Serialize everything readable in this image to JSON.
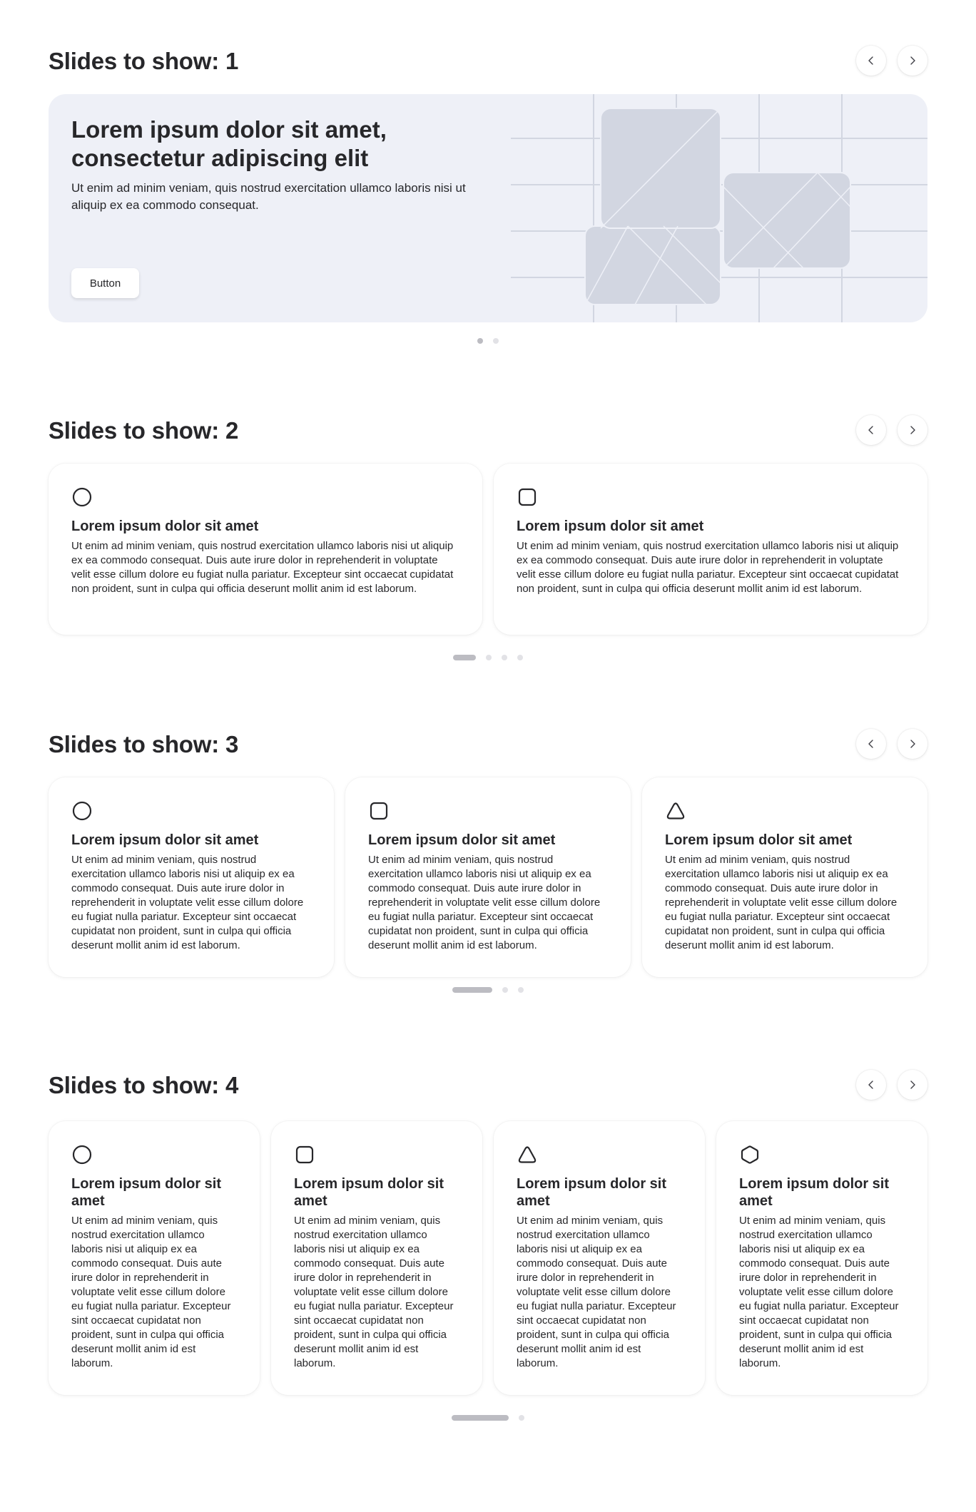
{
  "icons": {
    "prev": "chevron-left-icon",
    "next": "chevron-right-icon",
    "shapes": [
      "circle-icon",
      "square-icon",
      "triangle-icon",
      "hexagon-icon"
    ]
  },
  "colors": {
    "hero_bg": "#eef0f7",
    "dot_active": "#bcbcc2",
    "dot_inactive": "#e2e2e6",
    "text": "#27272a"
  },
  "sections": [
    {
      "title": "Slides to show: 1",
      "hero": {
        "title": "Lorem ipsum dolor sit amet, consectetur adipiscing elit",
        "description": "Ut enim ad minim veniam, quis nostrud exercitation ullamco laboris nisi ut aliquip ex ea commodo consequat.",
        "button": "Button"
      },
      "dots": {
        "count": 2,
        "active": 1
      }
    },
    {
      "title": "Slides to show: 2",
      "cards": [
        {
          "icon": "circle-icon",
          "title": "Lorem ipsum dolor sit amet",
          "text": "Ut enim ad minim veniam, quis nostrud exercitation ullamco laboris nisi ut aliquip ex ea commodo consequat. Duis aute irure dolor in reprehenderit in voluptate velit esse cillum dolore eu fugiat nulla pariatur. Excepteur sint occaecat cupidatat non proident, sunt in culpa qui officia deserunt mollit anim id est laborum."
        },
        {
          "icon": "square-icon",
          "title": "Lorem ipsum dolor sit amet",
          "text": "Ut enim ad minim veniam, quis nostrud exercitation ullamco laboris nisi ut aliquip ex ea commodo consequat. Duis aute irure dolor in reprehenderit in voluptate velit esse cillum dolore eu fugiat nulla pariatur. Excepteur sint occaecat cupidatat non proident, sunt in culpa qui officia deserunt mollit anim id est laborum."
        }
      ],
      "dots": {
        "count": 4,
        "active": 1
      }
    },
    {
      "title": "Slides to show: 3",
      "cards": [
        {
          "icon": "circle-icon",
          "title": "Lorem ipsum dolor sit amet",
          "text": "Ut enim ad minim veniam, quis nostrud exercitation ullamco laboris nisi ut aliquip ex ea commodo consequat. Duis aute irure dolor in reprehenderit in voluptate velit esse cillum dolore eu fugiat nulla pariatur. Excepteur sint occaecat cupidatat non proident, sunt in culpa qui officia deserunt mollit anim id est laborum."
        },
        {
          "icon": "square-icon",
          "title": "Lorem ipsum dolor sit amet",
          "text": "Ut enim ad minim veniam, quis nostrud exercitation ullamco laboris nisi ut aliquip ex ea commodo consequat. Duis aute irure dolor in reprehenderit in voluptate velit esse cillum dolore eu fugiat nulla pariatur. Excepteur sint occaecat cupidatat non proident, sunt in culpa qui officia deserunt mollit anim id est laborum."
        },
        {
          "icon": "triangle-icon",
          "title": "Lorem ipsum dolor sit amet",
          "text": "Ut enim ad minim veniam, quis nostrud exercitation ullamco laboris nisi ut aliquip ex ea commodo consequat. Duis aute irure dolor in reprehenderit in voluptate velit esse cillum dolore eu fugiat nulla pariatur. Excepteur sint occaecat cupidatat non proident, sunt in culpa qui officia deserunt mollit anim id est laborum."
        }
      ],
      "dots": {
        "count": 3,
        "active": 1
      }
    },
    {
      "title": "Slides to show: 4",
      "cards": [
        {
          "icon": "circle-icon",
          "title": "Lorem ipsum dolor sit amet",
          "text": "Ut enim ad minim veniam, quis nostrud exercitation ullamco laboris nisi ut aliquip ex ea commodo consequat. Duis aute irure dolor in reprehenderit in voluptate velit esse cillum dolore eu fugiat nulla pariatur. Excepteur sint occaecat cupidatat non proident, sunt in culpa qui officia deserunt mollit anim id est laborum."
        },
        {
          "icon": "square-icon",
          "title": "Lorem ipsum dolor sit amet",
          "text": "Ut enim ad minim veniam, quis nostrud exercitation ullamco laboris nisi ut aliquip ex ea commodo consequat. Duis aute irure dolor in reprehenderit in voluptate velit esse cillum dolore eu fugiat nulla pariatur. Excepteur sint occaecat cupidatat non proident, sunt in culpa qui officia deserunt mollit anim id est laborum."
        },
        {
          "icon": "triangle-icon",
          "title": "Lorem ipsum dolor sit amet",
          "text": "Ut enim ad minim veniam, quis nostrud exercitation ullamco laboris nisi ut aliquip ex ea commodo consequat. Duis aute irure dolor in reprehenderit in voluptate velit esse cillum dolore eu fugiat nulla pariatur. Excepteur sint occaecat cupidatat non proident, sunt in culpa qui officia deserunt mollit anim id est laborum."
        },
        {
          "icon": "hexagon-icon",
          "title": "Lorem ipsum dolor sit amet",
          "text": "Ut enim ad minim veniam, quis nostrud exercitation ullamco laboris nisi ut aliquip ex ea commodo consequat. Duis aute irure dolor in reprehenderit in voluptate velit esse cillum dolore eu fugiat nulla pariatur. Excepteur sint occaecat cupidatat non proident, sunt in culpa qui officia deserunt mollit anim id est laborum."
        }
      ],
      "dots": {
        "count": 2,
        "active": 1
      }
    }
  ]
}
